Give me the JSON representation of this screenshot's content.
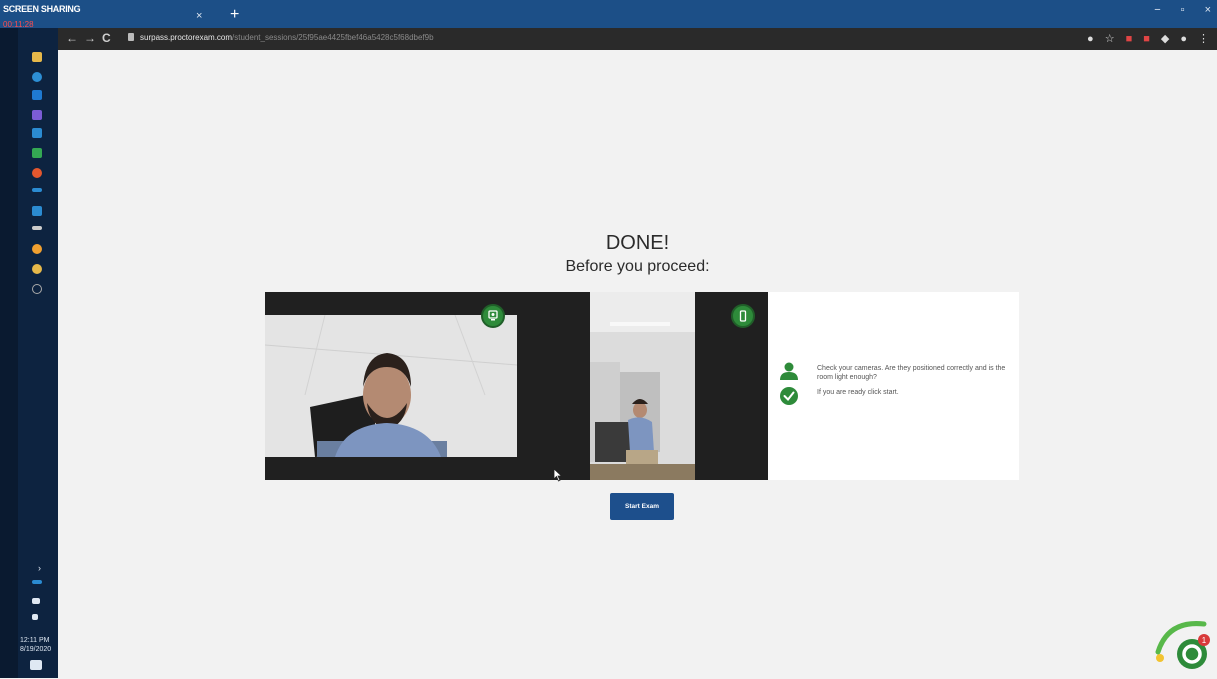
{
  "recording": {
    "label": "SCREEN SHARING",
    "time": "00:11:28"
  },
  "browser": {
    "tab_close": "×",
    "new_tab": "+",
    "nav": {
      "back": "←",
      "forward": "→",
      "reload": "C"
    },
    "url_host": "surpass.proctorexam.com",
    "url_path": "/student_sessions/25f95ae4425fbef46a5428c5f68dbef9b"
  },
  "window_controls": {
    "minimize": "−",
    "maximize": "▫",
    "close": "×"
  },
  "taskbar": {
    "time": "12:11 PM",
    "date": "8/19/2020"
  },
  "page": {
    "title": "DONE!",
    "subtitle": "Before you proceed:",
    "instructions": [
      "Check your cameras. Are they positioned correctly and is the room light enough?",
      "If you are ready click start."
    ],
    "start_button": "Start Exam"
  },
  "colors": {
    "accent_green": "#2e8b3a",
    "button_blue": "#1d4f8c",
    "chrome_blue": "#1c4f87"
  },
  "icons": {
    "webcam_badge": "webcam-icon",
    "phone_badge": "phone-icon",
    "person": "person-icon",
    "check": "check-icon"
  },
  "helper_badge": {
    "count": "1"
  }
}
